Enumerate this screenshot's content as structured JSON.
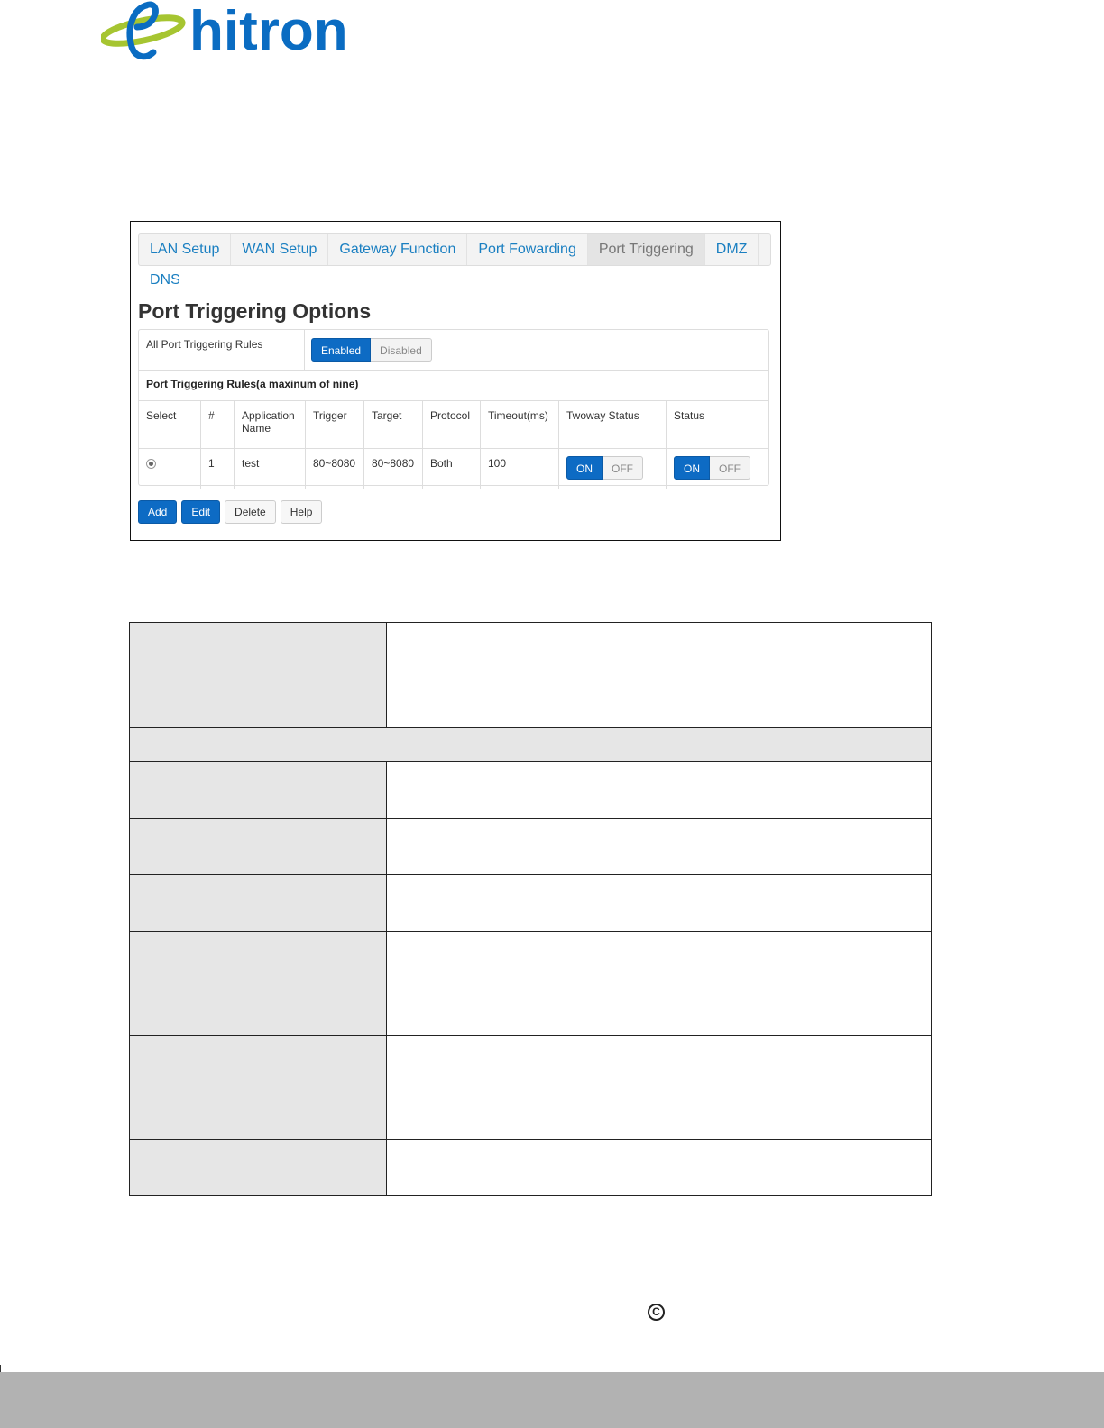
{
  "logo": {
    "text": "hitron"
  },
  "nav": {
    "tabs": [
      {
        "label": "LAN Setup"
      },
      {
        "label": "WAN Setup"
      },
      {
        "label": "Gateway Function"
      },
      {
        "label": "Port Fowarding"
      },
      {
        "label": "Port Triggering",
        "active": true
      },
      {
        "label": "DMZ"
      }
    ],
    "second_row_tab": "DNS"
  },
  "page": {
    "title": "Port Triggering Options"
  },
  "all_rules": {
    "label": "All Port Triggering Rules",
    "enabled_label": "Enabled",
    "disabled_label": "Disabled",
    "selected": "Enabled"
  },
  "rules": {
    "title": "Port Triggering Rules(a maxinum of nine)",
    "columns": [
      "Select",
      "#",
      "Application Name",
      "Trigger",
      "Target",
      "Protocol",
      "Timeout(ms)",
      "Twoway Status",
      "Status"
    ],
    "rows": [
      {
        "number": "1",
        "application_name": "test",
        "trigger": "80~8080",
        "target": "80~8080",
        "protocol": "Both",
        "timeout": "100",
        "twoway_on": "ON",
        "twoway_off": "OFF",
        "status_on": "ON",
        "status_off": "OFF"
      }
    ]
  },
  "actions": {
    "add": "Add",
    "edit": "Edit",
    "delete": "Delete",
    "help": "Help"
  },
  "colors": {
    "accent": "#0d6bc4",
    "tab_link": "#1a7fc1",
    "logo_blue": "#0a6cc2",
    "logo_green": "#a6c531",
    "footer": "#b2b2b2"
  },
  "footer": {
    "copyright_symbol": "C"
  }
}
